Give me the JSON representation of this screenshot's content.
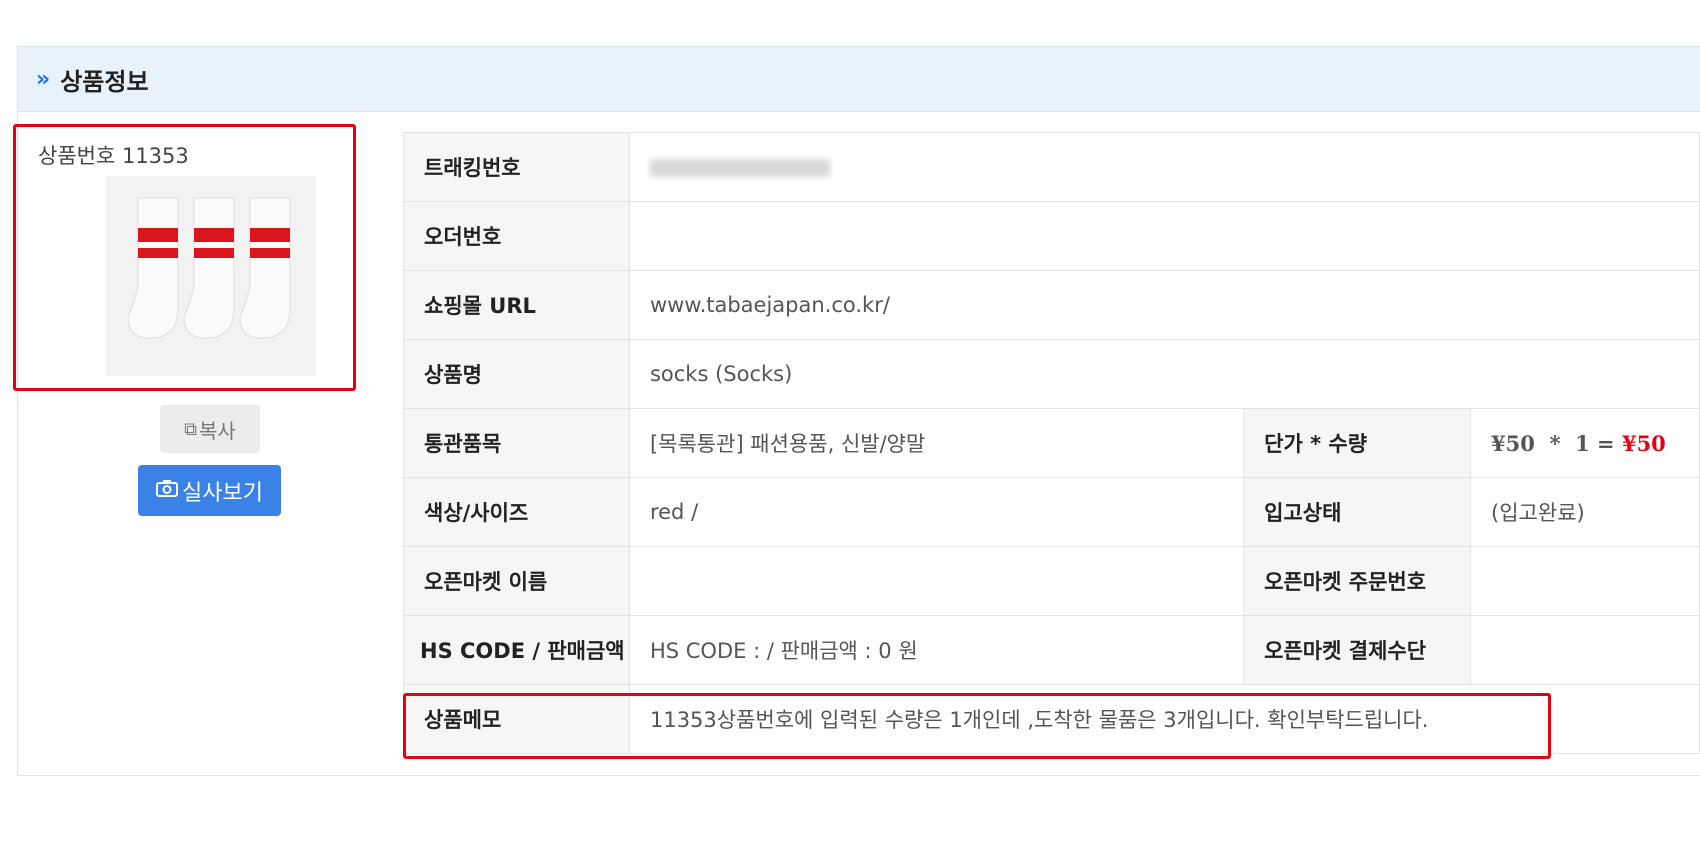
{
  "header": {
    "chevron": "»",
    "title": "상품정보"
  },
  "product": {
    "number_label": "상품번호 11353",
    "image_icon": "socks-product-image",
    "copy_label": "복사",
    "photo_label": "실사보기"
  },
  "fields": {
    "tracking_label": "트래킹번호",
    "tracking_value": "",
    "order_label": "오더번호",
    "order_value": "",
    "url_label": "쇼핑몰 URL",
    "url_value": "www.tabaejapan.co.kr/",
    "name_label": "상품명",
    "name_value": "socks (Socks)",
    "customs_label": "통관품목",
    "customs_value": "[목록통관] 패션용품, 신발/양말",
    "price_label": "단가 * 수량",
    "price_value": "¥50  *  1 = ",
    "price_total": "¥50",
    "color_label": "색상/사이즈",
    "color_value": "red /",
    "status_label": "입고상태",
    "status_value": "(입고완료)",
    "market_name_label": "오픈마켓 이름",
    "market_name_value": "",
    "market_order_label": "오픈마켓 주문번호",
    "market_order_value": "",
    "hs_label": "HS CODE / 판매금액",
    "hs_value": "HS CODE : / 판매금액 : 0 원",
    "market_pay_label": "오픈마켓 결제수단",
    "market_pay_value": "",
    "memo_label": "상품메모",
    "memo_value": "11353상품번호에 입력된 수량은 1개인데 ,도착한 물품은 3개입니다. 확인부탁드립니다."
  },
  "colors": {
    "accent": "#1a73e8",
    "highlight": "#e60012",
    "header_bg": "#e8f2fb",
    "button_blue": "#3b82e6"
  }
}
